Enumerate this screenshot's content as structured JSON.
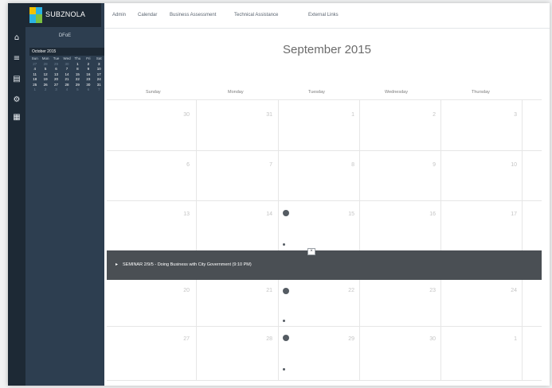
{
  "brand": {
    "name": "SUBZNOLA",
    "colors": [
      "#f2c200",
      "#2bb3e3",
      "#7ac142"
    ]
  },
  "topnav": [
    "Admin",
    "Calendar",
    "Business Assessment",
    "Technical Assistance",
    "External Links"
  ],
  "iconbar": [
    "home-icon",
    "list-icon",
    "document-icon",
    "gear-icon",
    "report-icon"
  ],
  "sidebar": {
    "calendar_user": "DFoE",
    "mini_calendar": {
      "title": "October 2015",
      "dow": [
        "Sun",
        "Mon",
        "Tue",
        "Wed",
        "Thu",
        "Fri",
        "Sat"
      ],
      "weeks": [
        [
          "27",
          "28",
          "29",
          "30",
          "1",
          "2",
          "3"
        ],
        [
          "4",
          "5",
          "6",
          "7",
          "8",
          "9",
          "10"
        ],
        [
          "11",
          "12",
          "13",
          "14",
          "15",
          "16",
          "17"
        ],
        [
          "18",
          "19",
          "20",
          "21",
          "22",
          "23",
          "24"
        ],
        [
          "25",
          "26",
          "27",
          "28",
          "29",
          "30",
          "31"
        ],
        [
          "1",
          "2",
          "3",
          "4",
          "5",
          "6",
          "7"
        ]
      ]
    }
  },
  "calendar": {
    "title": "September 2015",
    "days_of_week": [
      "Sunday",
      "Monday",
      "Tuesday",
      "Wednesday",
      "Thursday"
    ],
    "rows": [
      [
        "30",
        "31",
        "1",
        "2",
        "3"
      ],
      [
        "6",
        "7",
        "8",
        "9",
        "10"
      ],
      [
        "13",
        "14",
        "15",
        "16",
        "17"
      ],
      [
        "20",
        "21",
        "22",
        "23",
        "24"
      ],
      [
        "27",
        "28",
        "29",
        "30",
        "1"
      ]
    ],
    "event_text": "SEMINAR 2/9/5 - Doing Business with City Government (9:10 PM)",
    "event_close": "×"
  }
}
